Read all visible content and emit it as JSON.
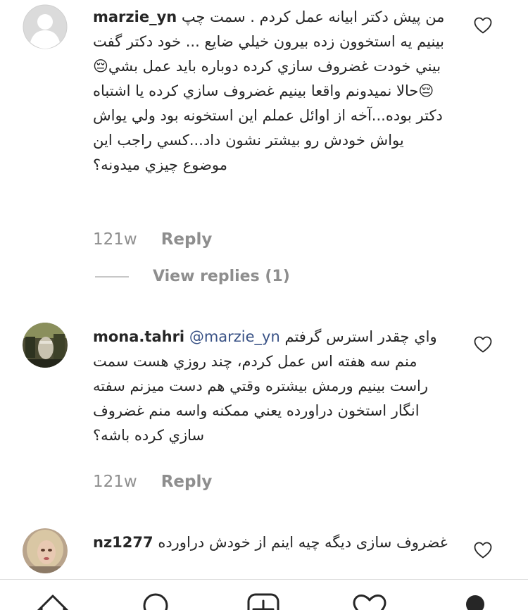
{
  "comments": [
    {
      "username": "marzie_yn",
      "mention": "",
      "text": "من پیش دکتر ابیانه عمل کردم . سمت چپ بینیم یه استخوون زده بیرون خیلي ضایع ... خود دکتر گفت بیني خودت غضروف سازي کرده دوباره باید عمل بشي😔😔حالا نمیدونم واقعا بینیم غضروف سازي کرده یا اشتباه دکتر بوده...آخه از اوائل عملم این استخونه بود ولي یواش یواش خودش رو بیشتر نشون داد...کسي راجب این موضوع چیزي میدونه؟",
      "time": "121w",
      "reply_label": "Reply"
    },
    {
      "username": "mona.tahri",
      "mention": "@marzie_yn",
      "text": "واي چقدر استرس گرفتم منم سه هفته اس عمل کردم، چند روزي هست سمت راست بینیم ورمش بیشتره وقتي هم دست میزنم سفته انگار استخون دراورده یعني ممکنه واسه منم غضروف سازي کرده باشه؟",
      "time": "121w",
      "reply_label": "Reply"
    },
    {
      "username": "nz1277",
      "mention": "",
      "text": "غضروف سازی دیگه چیه اینم از خودش دراورده"
    }
  ],
  "view_replies_label": "View replies (1)",
  "icons": {
    "like": "heart-outline-icon",
    "tabs": [
      "home-icon",
      "search-icon",
      "new-post-icon",
      "activity-heart-icon",
      "profile-icon"
    ]
  },
  "colors": {
    "mention": "#385185",
    "secondary": "#8e8e8e"
  }
}
